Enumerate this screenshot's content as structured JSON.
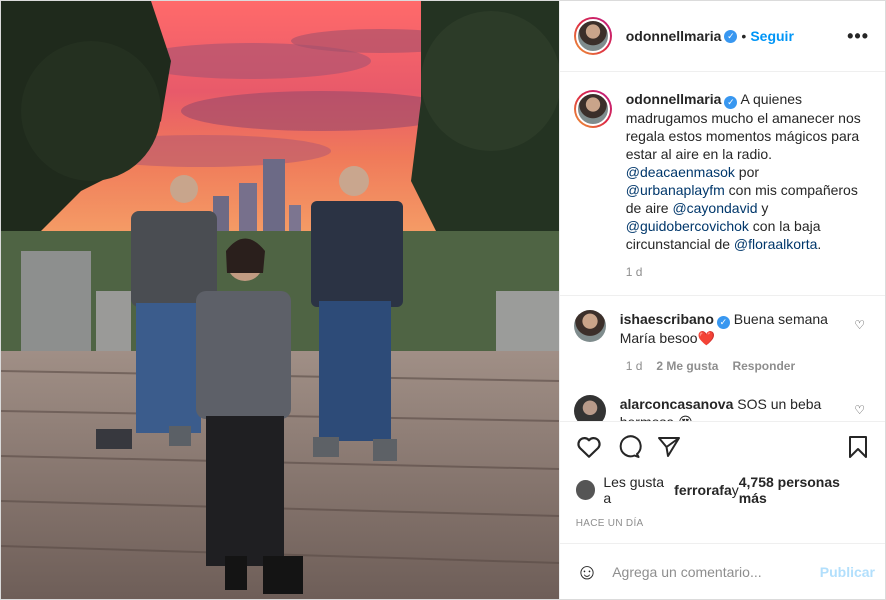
{
  "post": {
    "user": "odonnellmaria",
    "follow_label": "Seguir",
    "dot": "•",
    "more": "•••",
    "caption": {
      "user": "odonnellmaria",
      "text1": "A quienes madrugamos mucho el amanecer nos regala estos momentos mágicos para estar al aire en la radio.",
      "mention1": "@deacaenmasok",
      "por": " por ",
      "mention2": "@urbanaplayfm",
      "text2": " con mis compañeros de aire ",
      "mention3": "@cayondavid",
      "y": " y ",
      "mention4": "@guidobercovichok",
      "text3": " con la baja circunstancial de ",
      "mention5": "@floraalkorta",
      "end": ".",
      "age": "1 d"
    },
    "comments": [
      {
        "user": "ishaescribano",
        "text": "Buena semana María besoo❤️",
        "age": "1 d",
        "likes": "2 Me gusta",
        "reply": "Responder"
      },
      {
        "user": "alarconcasanova",
        "text": "SOS un beba hermosa 😍"
      }
    ],
    "likes": {
      "prefix": "Les gusta a ",
      "user": "ferrorafa",
      "suffix": " y ",
      "count": "4,758 personas más"
    },
    "timestamp": "HACE UN DÍA",
    "add_comment_placeholder": "Agrega un comentario...",
    "publish_label": "Publicar"
  },
  "colors": {
    "accent": "#0095f6",
    "verified": "#3897f0",
    "heart": "#ed4956"
  }
}
